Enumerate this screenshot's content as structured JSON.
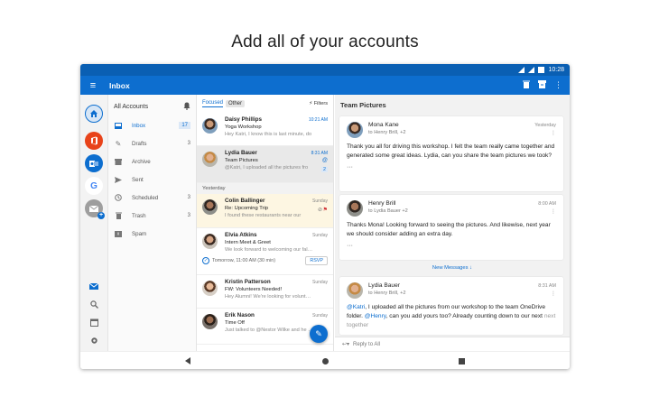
{
  "headline": "Add all of your accounts",
  "status": {
    "time": "10:28"
  },
  "appbar": {
    "title": "Inbox"
  },
  "accounts": {
    "google_letter": "G"
  },
  "folders": {
    "header": "All Accounts",
    "items": [
      {
        "label": "Inbox",
        "count": "17"
      },
      {
        "label": "Drafts",
        "count": "3"
      },
      {
        "label": "Archive",
        "count": ""
      },
      {
        "label": "Sent",
        "count": ""
      },
      {
        "label": "Scheduled",
        "count": "3"
      },
      {
        "label": "Trash",
        "count": "3"
      },
      {
        "label": "Spam",
        "count": ""
      }
    ]
  },
  "list": {
    "tab_focused": "Focused",
    "tab_other": "Other",
    "filters": "Filters",
    "section_yesterday": "Yesterday",
    "rsvp": "RSVP",
    "messages": [
      {
        "from": "Daisy Phillips",
        "subject": "Yoga Workshop",
        "preview": "Hey Katri, I know this is last minute, do",
        "time": "10:21 AM"
      },
      {
        "from": "Lydia Bauer",
        "subject": "Team Pictures",
        "preview": "@Katri, I uploaded all the pictures fro",
        "time": "8:31 AM",
        "badge": "2"
      },
      {
        "from": "Colin Ballinger",
        "subject": "Re: Upcoming Trip",
        "preview": "I found these restaurants near our",
        "time": "Sunday"
      },
      {
        "from": "Elvia Atkins",
        "subject": "Intern Meet & Greet",
        "preview": "We look forward to welcoming our fall int",
        "time": "Sunday",
        "event": "Tomorrow, 11:00 AM (30 min)"
      },
      {
        "from": "Kristin Patterson",
        "subject": "FW: Volunteers Needed!",
        "preview": "Hey Alumni! We're looking for volunteers",
        "time": "Sunday"
      },
      {
        "from": "Erik Nason",
        "subject": "Time Off",
        "preview": "Just talked to @Nestor Wilke and he will",
        "time": "Sunday"
      }
    ]
  },
  "reading": {
    "title": "Team Pictures",
    "new_messages": "New Messages",
    "reply": "Reply to All",
    "cards": [
      {
        "from": "Mona Kane",
        "to": "to Henry Brill, +2",
        "date": "Yesterday",
        "body": "Thank you all for driving this workshop. I felt the team really came together and generated some great ideas. Lydia, can you share the team pictures we took?"
      },
      {
        "from": "Henry Brill",
        "to": "to Lydia Bauer +2",
        "date": "8:00 AM",
        "body": "Thanks Mona! Looking forward to seeing the pictures. And likewise, next year we should consider adding an extra day."
      },
      {
        "from": "Lydia Bauer",
        "to": "to Henry Brill, +2",
        "date": "8:31 AM",
        "mention1": "@Katri",
        "body1": ", I uploaded all the pictures from our workshop to the team OneDrive folder. ",
        "mention2": "@Henry",
        "body2": ", can you add yours too? Already counting down to our next",
        "body3": "next together"
      }
    ]
  },
  "colors": {
    "brand": "#0d6ecf",
    "statusbar": "#0a5fb3",
    "flag": "#d13438"
  }
}
